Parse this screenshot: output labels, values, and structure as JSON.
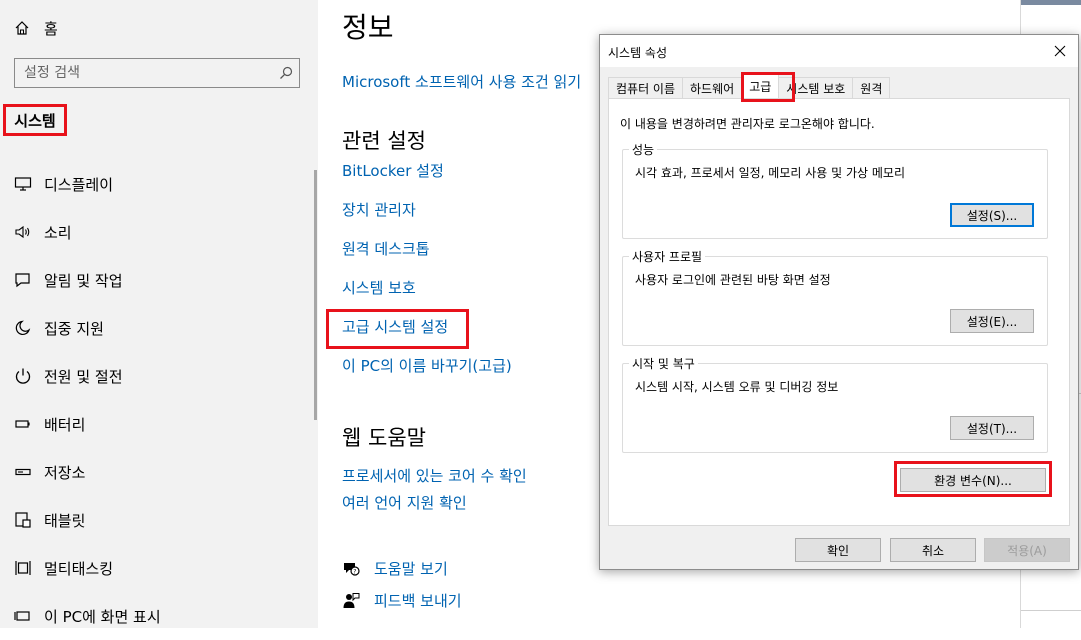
{
  "sidebar": {
    "home_label": "홈",
    "search_placeholder": "설정 검색",
    "section_title": "시스템",
    "items": [
      {
        "label": "디스플레이",
        "icon": "monitor-icon"
      },
      {
        "label": "소리",
        "icon": "speaker-icon"
      },
      {
        "label": "알림 및 작업",
        "icon": "notification-icon"
      },
      {
        "label": "집중 지원",
        "icon": "moon-icon"
      },
      {
        "label": "전원 및 절전",
        "icon": "power-icon"
      },
      {
        "label": "배터리",
        "icon": "battery-icon"
      },
      {
        "label": "저장소",
        "icon": "storage-icon"
      },
      {
        "label": "태블릿",
        "icon": "tablet-icon"
      },
      {
        "label": "멀티태스킹",
        "icon": "multitasking-icon"
      },
      {
        "label": "이 PC에 화면 표시",
        "icon": "project-icon"
      }
    ]
  },
  "main": {
    "page_title": "정보",
    "top_link": "Microsoft 소프트웨어 사용 조건 읽기",
    "related_heading": "관련 설정",
    "related_links": [
      "BitLocker 설정",
      "장치 관리자",
      "원격 데스크톱",
      "시스템 보호",
      "고급 시스템 설정",
      "이 PC의 이름 바꾸기(고급)"
    ],
    "web_help_heading": "웹 도움말",
    "web_help_links": [
      "프로세서에 있는 코어 수 확인",
      "여러 언어 지원 확인"
    ],
    "help_link": "도움말 보기",
    "feedback_link": "피드백 보내기"
  },
  "dialog": {
    "title": "시스템 속성",
    "tabs": [
      "컴퓨터 이름",
      "하드웨어",
      "고급",
      "시스템 보호",
      "원격"
    ],
    "active_tab": "고급",
    "notice": "이 내용을 변경하려면 관리자로 로그온해야 합니다.",
    "groups": [
      {
        "legend": "성능",
        "desc": "시각 효과, 프로세서 일정, 메모리 사용 및 가상 메모리",
        "button": "설정(S)..."
      },
      {
        "legend": "사용자 프로필",
        "desc": "사용자 로그인에 관련된 바탕 화면 설정",
        "button": "설정(E)..."
      },
      {
        "legend": "시작 및 복구",
        "desc": "시스템 시작, 시스템 오류 및 디버깅 정보",
        "button": "설정(T)..."
      }
    ],
    "env_button": "환경 변수(N)...",
    "ok_button": "확인",
    "cancel_button": "취소",
    "apply_button": "적용(A)"
  },
  "colors": {
    "accent_link": "#0063b1",
    "highlight_red": "#e8121b",
    "focus_blue": "#0078d7"
  }
}
